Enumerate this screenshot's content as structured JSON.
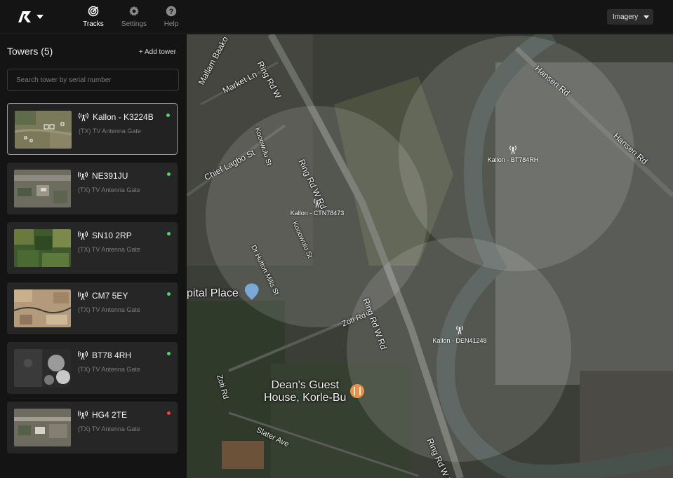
{
  "topbar": {
    "nav": [
      {
        "label": "Tracks",
        "icon": "radar-icon",
        "active": true
      },
      {
        "label": "Settings",
        "icon": "gear-icon",
        "active": false
      },
      {
        "label": "Help",
        "icon": "help-icon",
        "active": false
      }
    ],
    "imagery_label": "Imagery"
  },
  "sidebar": {
    "title": "Towers (5)",
    "add_label": "+ Add tower",
    "search_placeholder": "Search tower by serial number",
    "towers": [
      {
        "name": "Kallon - K3224B",
        "type": "(TX) TV Antenna Gate",
        "status": "online",
        "status_color": "#4cd964",
        "selected": true
      },
      {
        "name": "NE391JU",
        "type": "(TX) TV Antenna Gate",
        "status": "online",
        "status_color": "#4cd964",
        "selected": false
      },
      {
        "name": "SN10 2RP",
        "type": "(TX) TV Antenna Gate",
        "status": "online",
        "status_color": "#4cd964",
        "selected": false
      },
      {
        "name": "CM7 5EY",
        "type": "(TX) TV Antenna Gate",
        "status": "online",
        "status_color": "#4cd964",
        "selected": false
      },
      {
        "name": "BT78 4RH",
        "type": "(TX) TV Antenna Gate",
        "status": "online",
        "status_color": "#4cd964",
        "selected": false
      },
      {
        "name": "HG4 2TE",
        "type": "(TX) TV Antenna Gate",
        "status": "offline",
        "status_color": "#ff3b30",
        "selected": false
      }
    ]
  },
  "map": {
    "towers": [
      {
        "label": "Kallon - CTN78473"
      },
      {
        "label": "Kallon - BT784RH"
      },
      {
        "label": "Kallon - DEN41248"
      }
    ],
    "streets": [
      "Mallam Baako",
      "Market Ln",
      "Ring Rd W",
      "Hansen Rd",
      "Hansen Rd",
      "Kooowulu St",
      "Chief Lagbo St",
      "Ring Rd W Rd",
      "Kooowulu St",
      "Dr Hutton Mills St",
      "Ring Rd W Rd",
      "Zoti Rd",
      "Zoti Rd",
      "Slater Ave",
      "Ring Rd W Rd"
    ],
    "pois": [
      "pital Place",
      "Dean's Guest\nHouse, Korle-Bu"
    ]
  }
}
